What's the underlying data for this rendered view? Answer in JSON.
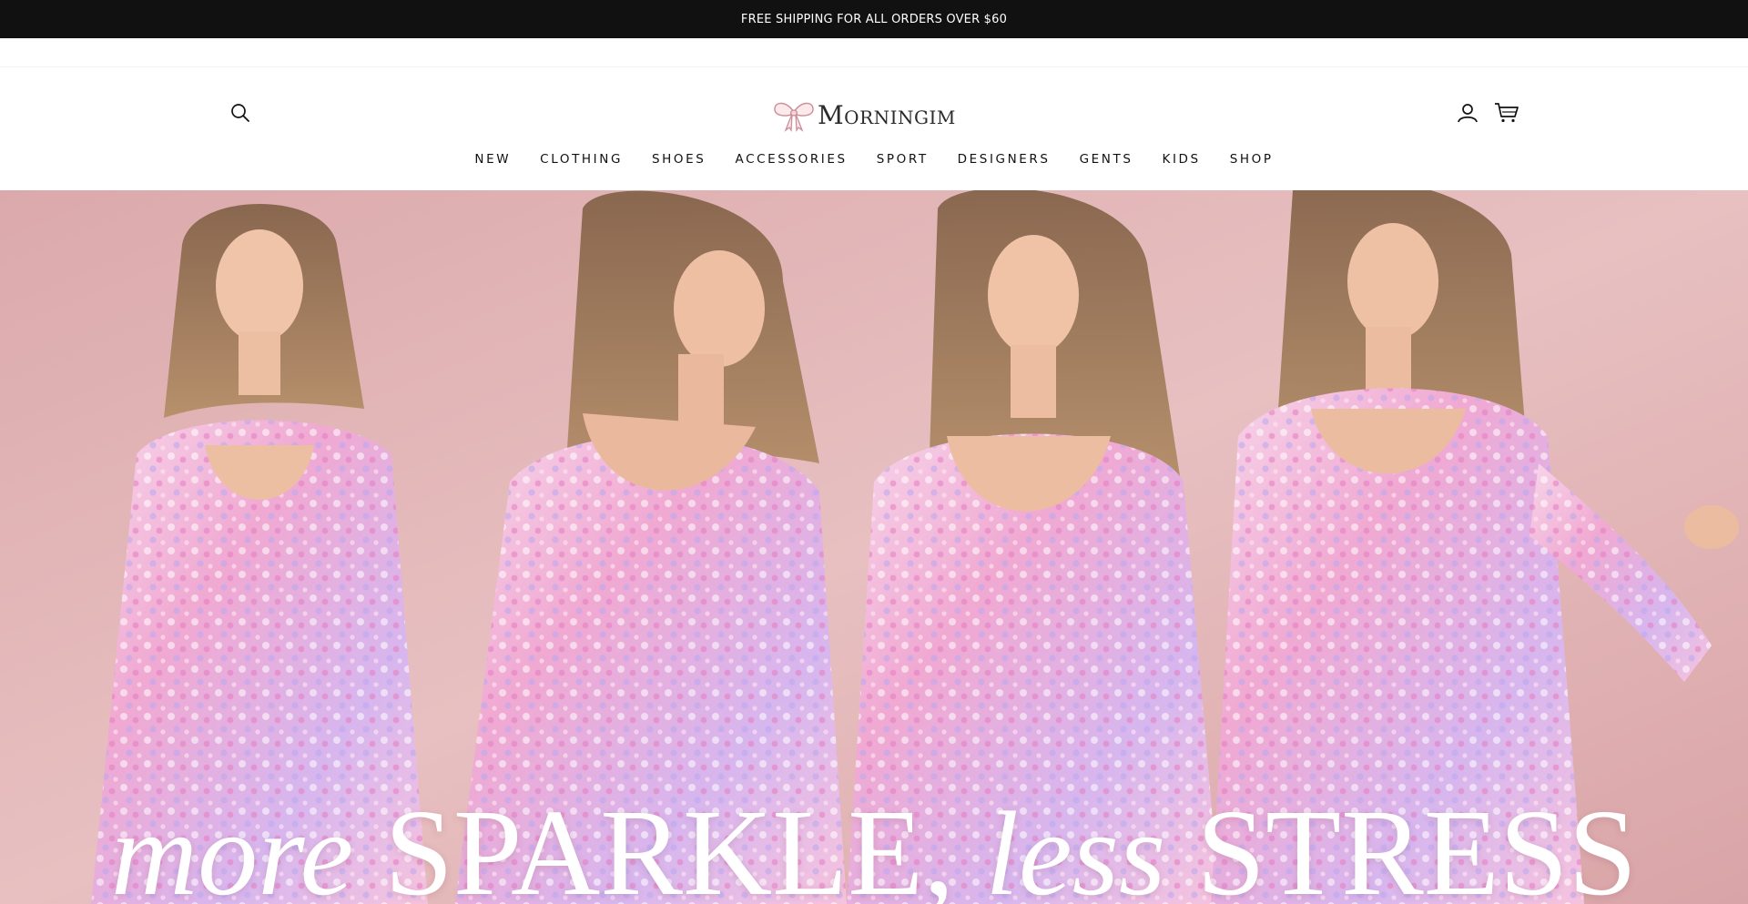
{
  "announcement": {
    "text": "FREE SHIPPING FOR ALL ORDERS OVER $60",
    "bg_color": "#111111",
    "text_color": "#ffffff"
  },
  "header": {
    "logo_text": "Morningim",
    "logo_icon": "bow-icon",
    "search_icon": "search-icon",
    "account_icon": "user-icon",
    "cart_icon": "cart-icon"
  },
  "nav": {
    "items": [
      {
        "label": "NEW"
      },
      {
        "label": "CLOTHING"
      },
      {
        "label": "SHOES"
      },
      {
        "label": "ACCESSORIES"
      },
      {
        "label": "SPORT"
      },
      {
        "label": "DESIGNERS"
      },
      {
        "label": "GENTS"
      },
      {
        "label": "KIDS"
      },
      {
        "label": "SHOP"
      }
    ]
  },
  "hero": {
    "headline_part1": "more",
    "headline_part2": "SPARKLE,",
    "headline_part3": "less",
    "headline_part4": "STRESS",
    "background_color": "#e3b8ba",
    "accent_color": "#f2a9cf"
  }
}
